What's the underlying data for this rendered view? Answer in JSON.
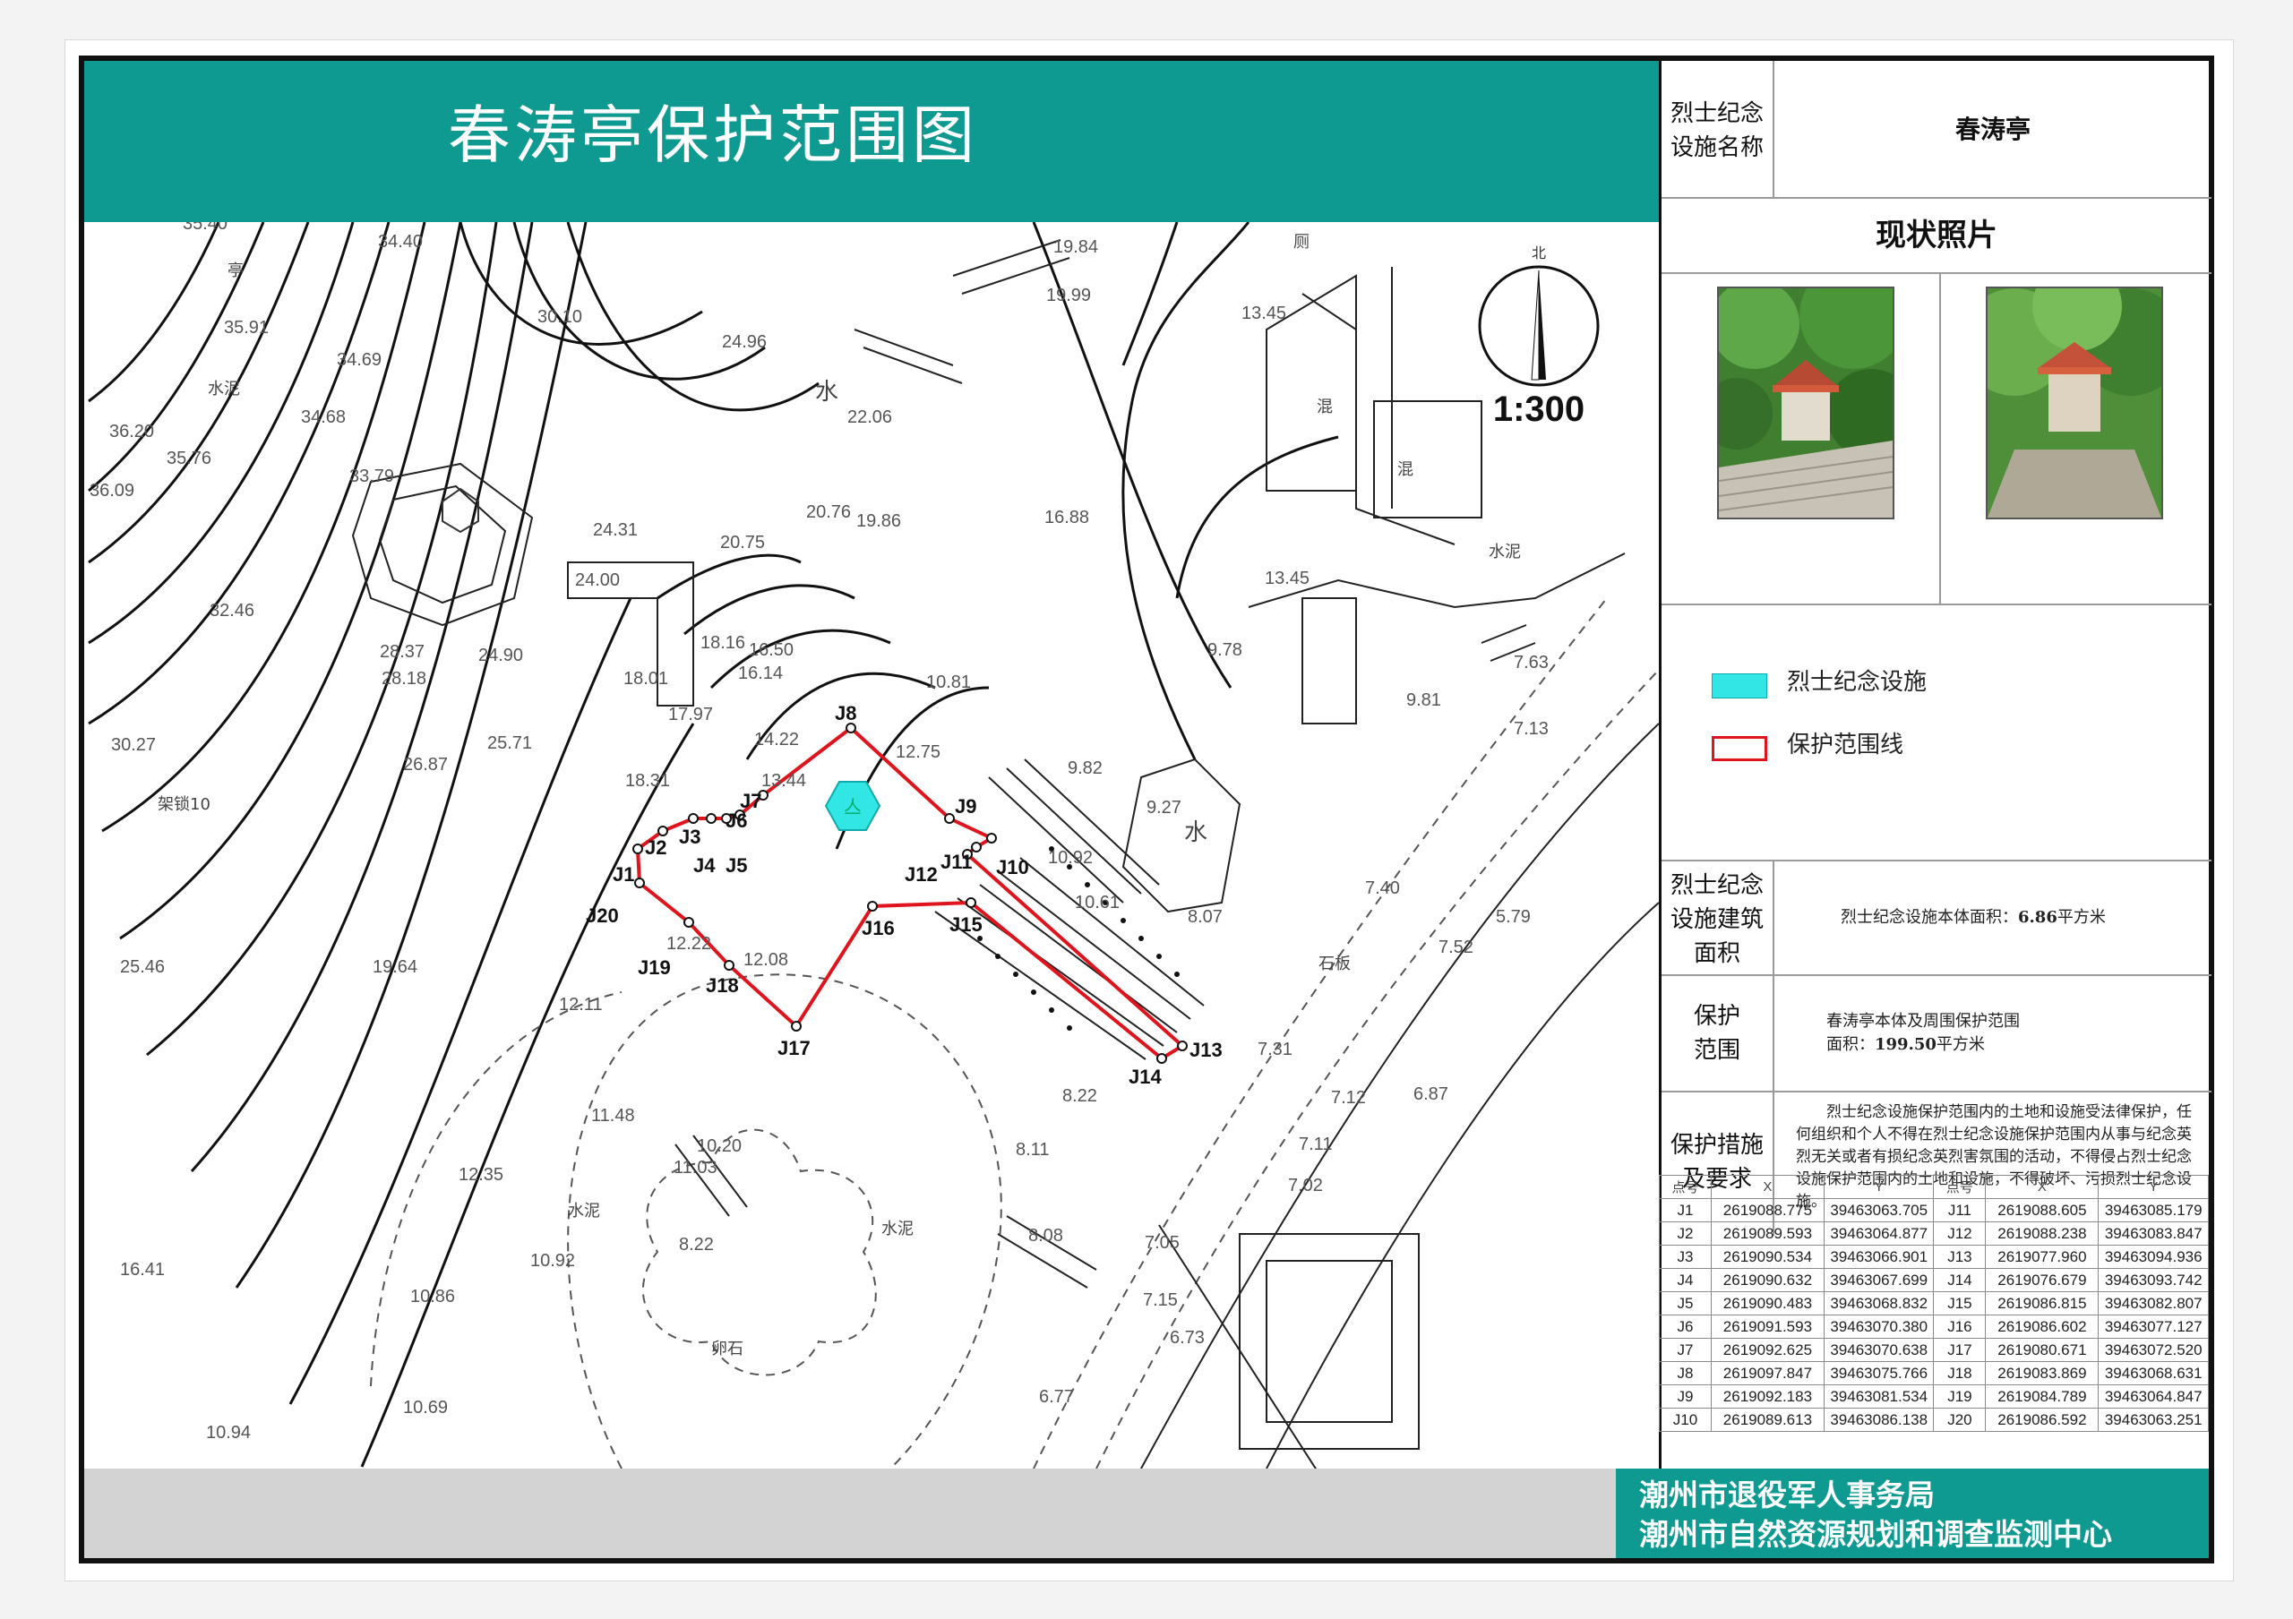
{
  "title": "春涛亭保护范围图",
  "scale": "1:300",
  "north_label": "北",
  "panel": {
    "facility_name_label": "烈士纪念\n设施名称",
    "facility_name": "春涛亭",
    "photo_header": "现状照片",
    "legend": [
      {
        "label": "烈士纪念设施",
        "color": "#33e6e6"
      },
      {
        "label": "保护范围线",
        "color": "#e0141c"
      }
    ],
    "area_label": "烈士纪念\n设施建筑\n面积",
    "area_text_prefix": "烈士纪念设施本体面积：",
    "area_value": "6.86",
    "area_unit": "平方米",
    "protect_label": "保护\n范围",
    "protect_line1": "春涛亭本体及周围保护范围",
    "protect_line2_prefix": "面积：",
    "protect_value": "199.50",
    "protect_unit": "平方米",
    "measures_label": "保护措施\n及要求",
    "measures_text": "烈士纪念设施保护范围内的土地和设施受法律保护，任何组织和个人不得在烈士纪念设施保护范围内从事与纪念英烈无关或者有损纪念英烈害氛围的活动，不得侵占烈士纪念设施保护范围内的土地和设施，不得破坏、污损烈士纪念设施。"
  },
  "coord_table": {
    "headers": [
      "点号",
      "X",
      "Y",
      "点号",
      "X",
      "Y"
    ],
    "rows": [
      [
        "J1",
        "2619088.775",
        "39463063.705",
        "J11",
        "2619088.605",
        "39463085.179"
      ],
      [
        "J2",
        "2619089.593",
        "39463064.877",
        "J12",
        "2619088.238",
        "39463083.847"
      ],
      [
        "J3",
        "2619090.534",
        "39463066.901",
        "J13",
        "2619077.960",
        "39463094.936"
      ],
      [
        "J4",
        "2619090.632",
        "39463067.699",
        "J14",
        "2619076.679",
        "39463093.742"
      ],
      [
        "J5",
        "2619090.483",
        "39463068.832",
        "J15",
        "2619086.815",
        "39463082.807"
      ],
      [
        "J6",
        "2619091.593",
        "39463070.380",
        "J16",
        "2619086.602",
        "39463077.127"
      ],
      [
        "J7",
        "2619092.625",
        "39463070.638",
        "J17",
        "2619080.671",
        "39463072.520"
      ],
      [
        "J8",
        "2619097.847",
        "39463075.766",
        "J18",
        "2619083.869",
        "39463068.631"
      ],
      [
        "J9",
        "2619092.183",
        "39463081.534",
        "J19",
        "2619084.789",
        "39463064.847"
      ],
      [
        "J10",
        "2619089.613",
        "39463086.138",
        "J20",
        "2619086.592",
        "39463063.251"
      ]
    ]
  },
  "org_lines": [
    "潮州市退役军人事务局",
    "潮州市自然资源规划和调查监测中心"
  ],
  "map": {
    "boundary_points": [
      {
        "id": "J8",
        "label": "J8"
      },
      {
        "id": "J9",
        "label": "J9"
      },
      {
        "id": "J10",
        "label": "J10"
      },
      {
        "id": "J11",
        "label": "J11"
      },
      {
        "id": "J12",
        "label": "J12"
      },
      {
        "id": "J13",
        "label": "J13"
      },
      {
        "id": "J14",
        "label": "J14"
      },
      {
        "id": "J15",
        "label": "J15"
      },
      {
        "id": "J16",
        "label": "J16"
      },
      {
        "id": "J17",
        "label": "J17"
      },
      {
        "id": "J18",
        "label": "J18"
      },
      {
        "id": "J19",
        "label": "J19"
      },
      {
        "id": "J20",
        "label": "J20"
      },
      {
        "id": "J1",
        "label": "J1"
      },
      {
        "id": "J2",
        "label": "J2"
      },
      {
        "id": "J3",
        "label": "J3"
      },
      {
        "id": "J4",
        "label": "J4"
      },
      {
        "id": "J5",
        "label": "J5"
      },
      {
        "id": "J6",
        "label": "J6"
      },
      {
        "id": "J7",
        "label": "J7"
      }
    ],
    "elevations": [
      "34.40",
      "35.91",
      "34.69",
      "34.68",
      "36.20",
      "35.76",
      "36.09",
      "33.79",
      "32.46",
      "28.37",
      "28.18",
      "30.27",
      "26.87",
      "25.71",
      "24.90",
      "24.31",
      "24.00",
      "18.01",
      "18.31",
      "17.97",
      "18.16",
      "16.50",
      "16.14",
      "14.22",
      "13.44",
      "12.75",
      "10.81",
      "9.82",
      "9.78",
      "30.10",
      "24.96",
      "22.06",
      "20.76",
      "19.86",
      "16.88",
      "19.84",
      "19.99",
      "13.45",
      "13.45",
      "9.81",
      "7.63",
      "7.13",
      "9.27",
      "10.92",
      "10.61",
      "8.07",
      "7.40",
      "5.79",
      "7.52",
      "7.31",
      "7.12",
      "6.87",
      "7.11",
      "7.02",
      "7.05",
      "7.15",
      "6.73",
      "8.22",
      "8.11",
      "8.08",
      "8.22",
      "6.77",
      "11.48",
      "12.35",
      "16.41",
      "10.92",
      "10.86",
      "10.69",
      "10.94",
      "25.46",
      "19.64",
      "12.11",
      "12.22",
      "12.08",
      "10.20",
      "11.03",
      "35.40",
      "20.75"
    ],
    "texts": [
      "水泥",
      "水",
      "混",
      "混",
      "水泥",
      "厕",
      "水",
      "石板",
      "水泥",
      "水泥",
      "卵石",
      "架锁10",
      "亭"
    ]
  }
}
